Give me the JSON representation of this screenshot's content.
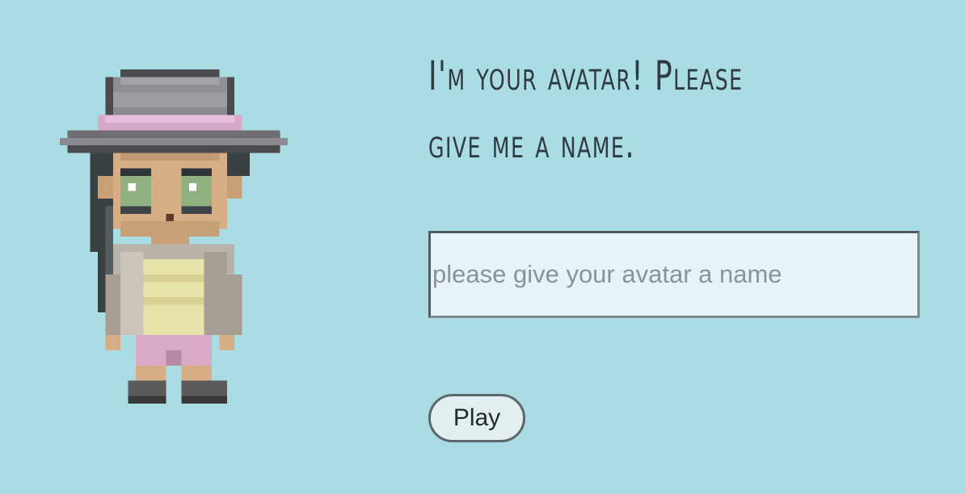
{
  "heading": {
    "line1": "I'm your avatar! Please",
    "line2": "give me a name."
  },
  "name_field": {
    "value": "",
    "placeholder": "please give your avatar a name"
  },
  "play_button": {
    "label": "Play"
  },
  "colors": {
    "background": "#a9dce3",
    "heading_text": "#2f3b40",
    "input_background": "#e6f4f8",
    "button_background": "#e3eef1"
  },
  "icons": {
    "avatar": "pixel-art-avatar-girl-with-hat"
  }
}
